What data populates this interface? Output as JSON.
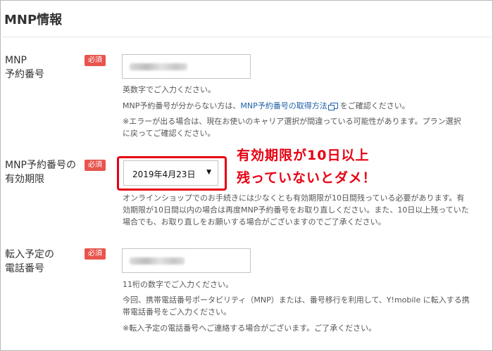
{
  "section_title": "MNP情報",
  "required_badge": "必須",
  "mnp_number": {
    "label_line1": "MNP",
    "label_line2": "予約番号",
    "help1": "英数字でご入力ください。",
    "help2_prefix": "MNP予約番号が分からない方は、",
    "help2_link": "MNP予約番号の取得方法",
    "help2_suffix": "をご確認ください。",
    "help3_line1": "※エラーが出る場合は、現在お使いのキャリア選択が間違っている可能性があります。プラン選択",
    "help3_line2": "に戻ってご確認ください。"
  },
  "expiry": {
    "label_line1": "MNP予約番号の",
    "label_line2": "有効期限",
    "selected_date": "2019年4月23日",
    "help_line1": "オンラインショップでのお手続きには少なくとも有効期限が10日間残っている必要があります。有",
    "help_line2": "効期限が10日間以内の場合は再度MNP予約番号をお取り直しください。また、10日以上残っていた",
    "help_line3": "場合でも、お取り直しをお願いする場合がございますのでご了承ください。"
  },
  "annotation": {
    "line1": "有効期限が10日以上",
    "line2": "残っていないとダメ！"
  },
  "phone": {
    "label_line1": "転入予定の",
    "label_line2": "電話番号",
    "help1": "11桁の数字でご入力ください。",
    "help2_line1": "今回、携帯電話番号ポータビリティ（MNP）または、番号移行を利用して、Y!mobile に転入する携",
    "help2_line2": "帯電話番号をご入力ください。",
    "help3": "※転入予定の電話番号へご連絡する場合がございます。ご了承ください。"
  },
  "colors": {
    "badge": "#e8554e",
    "link": "#1e5fa8",
    "annotation": "#e60012"
  },
  "icons": {
    "link_icon": "external-window-icon",
    "select_arrow": "dropdown-arrow-icon"
  }
}
